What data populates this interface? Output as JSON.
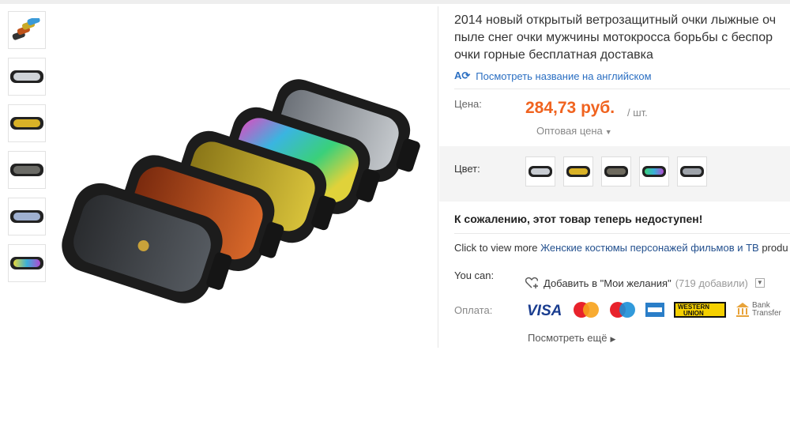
{
  "product": {
    "title_lines": [
      "2014 новый открытый ветрозащитный очки лыжные оч",
      "пыле снег очки мужчины мотокросса борьбы с беспор",
      "очки горные бесплатная доставка"
    ],
    "translate_link": "Посмотреть название на английском",
    "price_label": "Цена:",
    "price": "284,73 руб.",
    "unit": "/ шт.",
    "wholesale": "Оптовая цена",
    "color_label": "Цвет:",
    "unavailable": "К сожалению, этот товар теперь недоступен!",
    "category_prefix": "Click to view more ",
    "category_link": "Женские костюмы персонажей фильмов и ТВ",
    "category_suffix": " produ",
    "you_can_label": "You can:",
    "wishlist": "Добавить в \"Мои желания\"",
    "wishlist_count": "(719 добавили)",
    "payment_label": "Оплата:",
    "payment_methods": [
      "VISA",
      "MasterCard",
      "Maestro",
      "American Express",
      "WESTERN UNION",
      "Bank Transfer"
    ],
    "bank_line1": "Bank",
    "bank_line2": "Transfer",
    "more_link": "Посмотреть ещё"
  },
  "lens_colors": {
    "gray": "#3a3d41",
    "orange": "#c0531a",
    "yellow": "#c8a927",
    "rainbow": "#3a9ad8",
    "silver": "#8a8f96",
    "blue": "#7d8fb0"
  },
  "accent": {
    "price_color": "#f0631f",
    "link_color": "#2b6fc2"
  }
}
